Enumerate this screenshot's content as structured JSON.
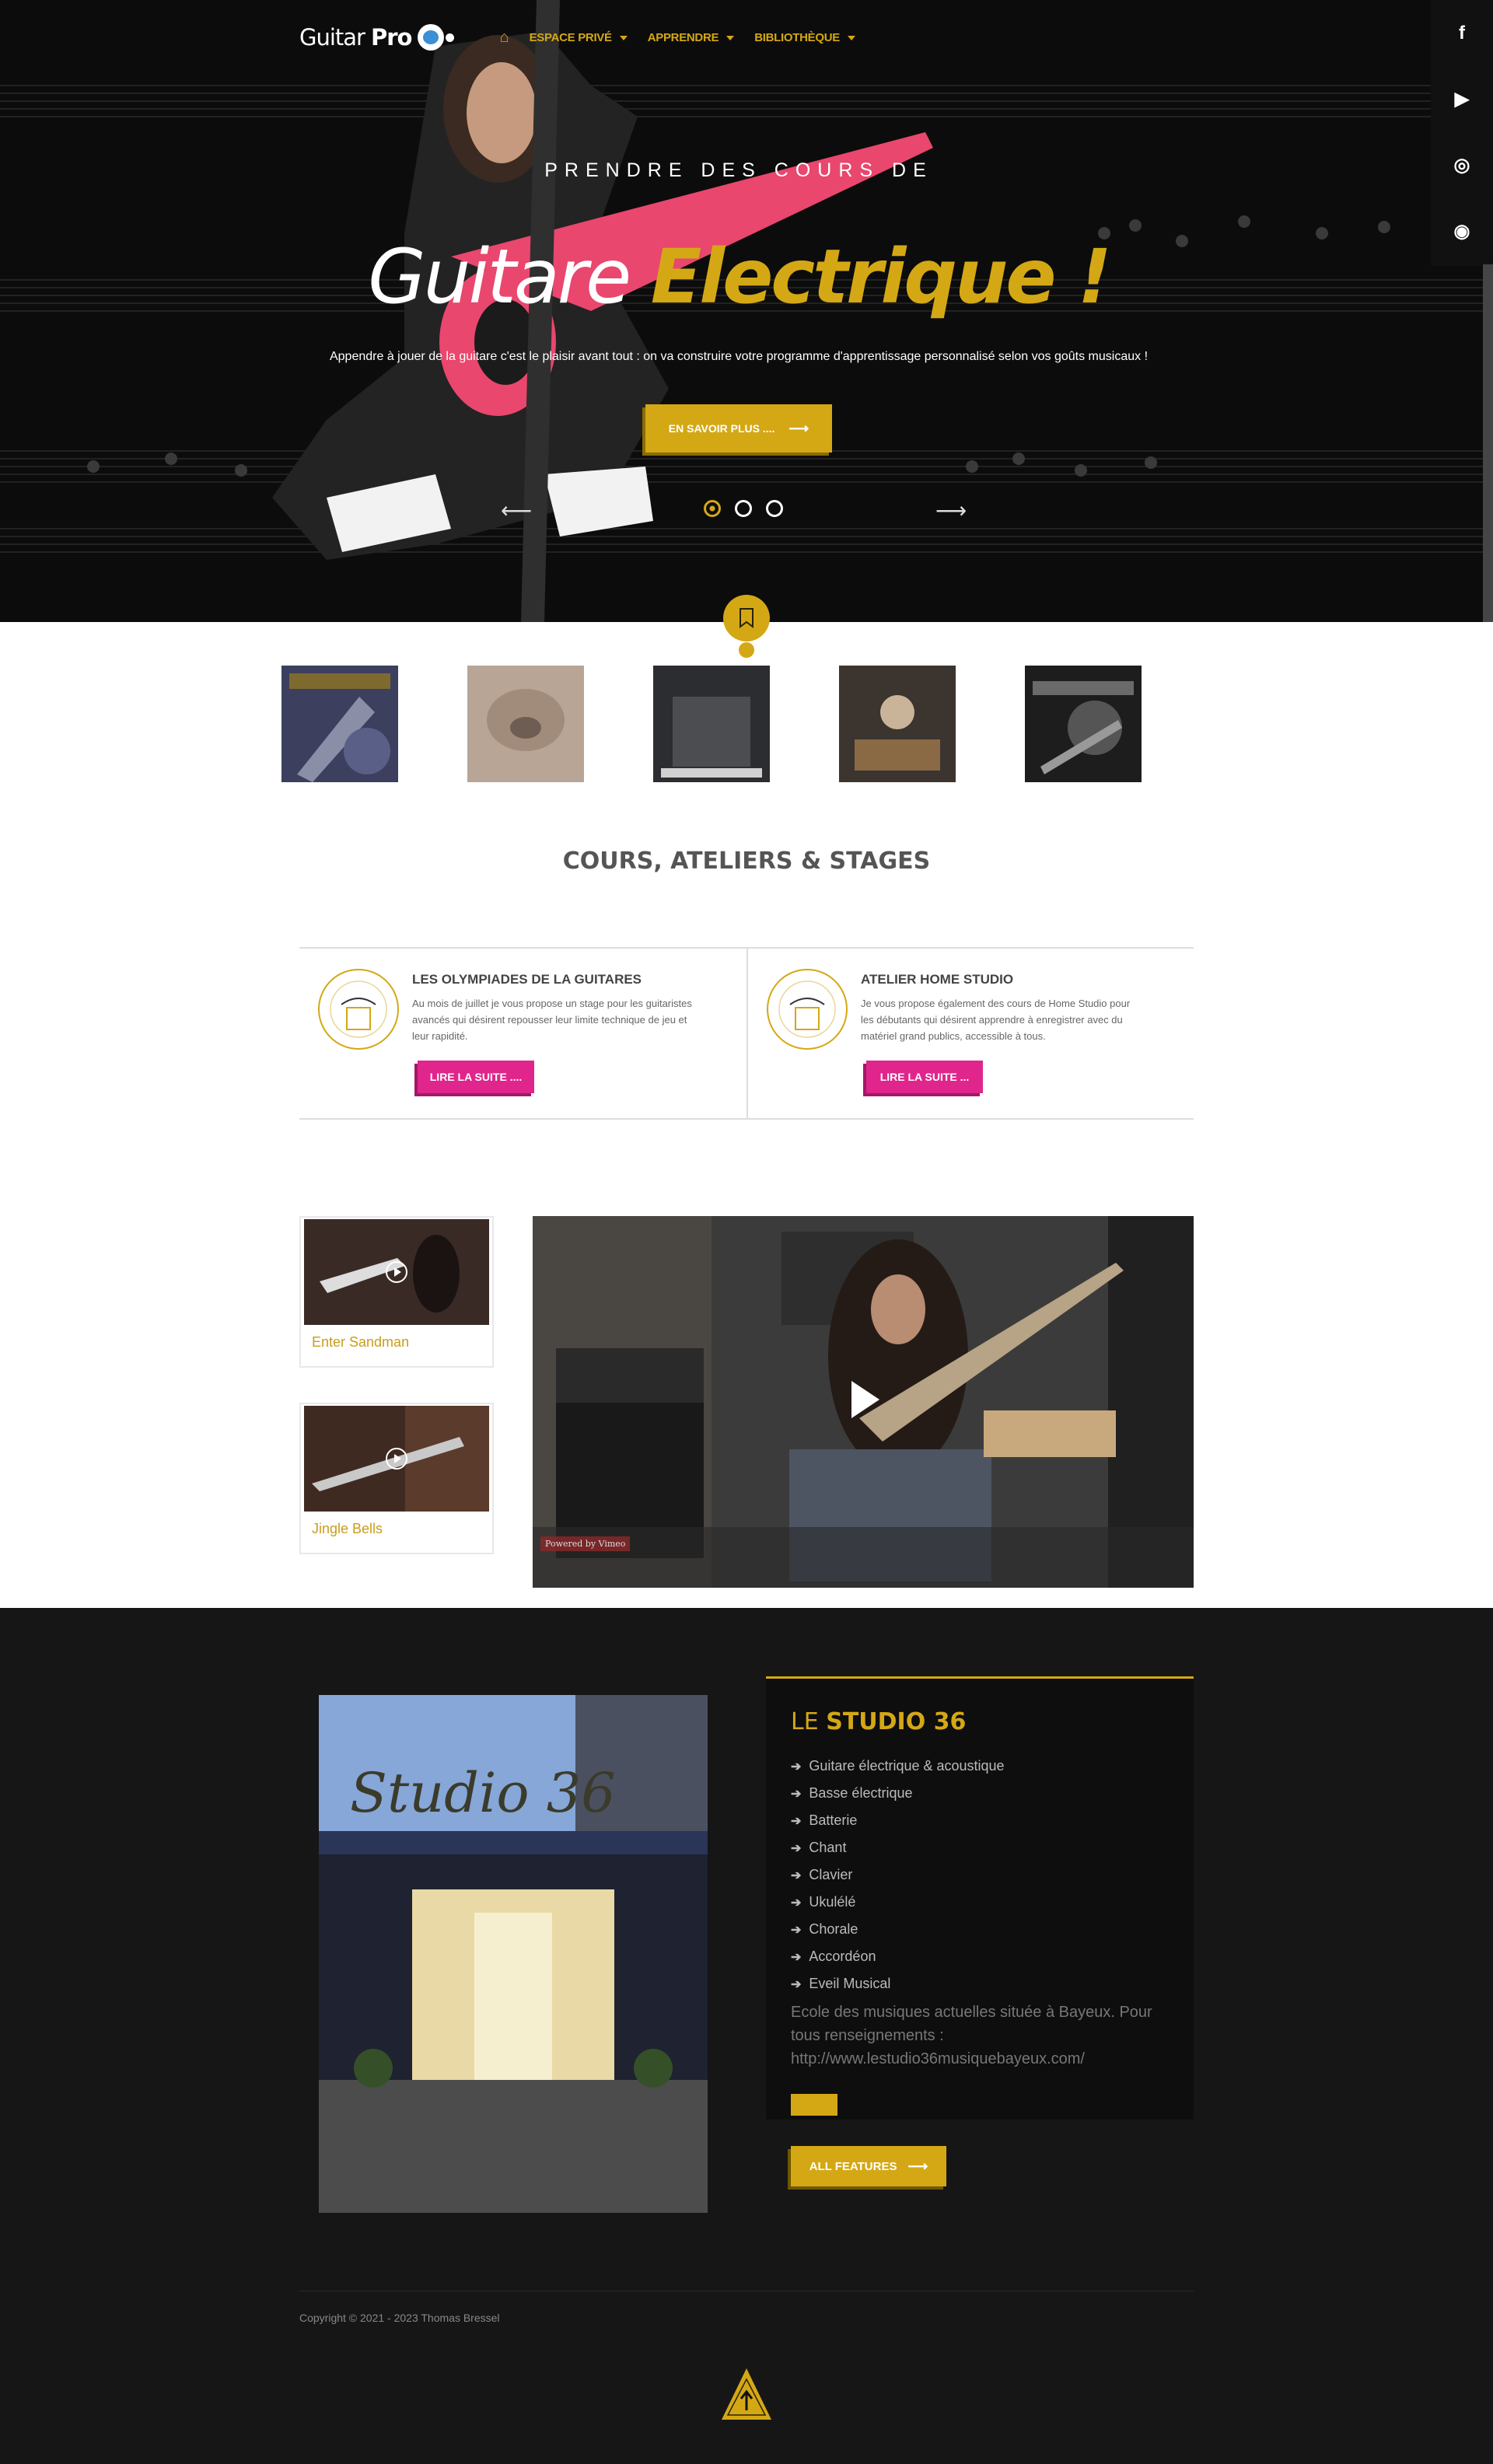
{
  "nav": {
    "logo_text": "Guitar",
    "logo_bold": "Pro",
    "home_icon": "home-icon",
    "items": [
      {
        "label": "ESPACE PRIVÉ"
      },
      {
        "label": "APPRENDRE"
      },
      {
        "label": "BIBLIOTHÈQUE"
      }
    ]
  },
  "social": [
    {
      "icon": "facebook-icon",
      "glyph": "f"
    },
    {
      "icon": "youtube-icon",
      "glyph": "▶"
    },
    {
      "icon": "instagram-icon",
      "glyph": "◎"
    },
    {
      "icon": "periscope-icon",
      "glyph": "◉"
    }
  ],
  "hero": {
    "pretitle": "PRENDRE DES COURS DE",
    "title_white": "Guitare",
    "title_yellow": "Electrique !",
    "subtitle": "Appendre à jouer de la guitare c'est le plaisir avant tout : on va construire votre programme d'apprentissage personnalisé selon vos goûts musicaux !",
    "cta_label": "EN SAVOIR PLUS ....",
    "slides": 3,
    "active_slide": 1
  },
  "courses_section": {
    "title": "COURS, ATELIERS & STAGES",
    "items": [
      {
        "title": "LES OLYMPIADES DE LA GUITARES",
        "text": "Au mois de juillet je vous propose un stage pour les guitaristes avancés qui désirent repousser leur limite technique de jeu et leur rapidité.",
        "button": "LIRE LA SUITE ...."
      },
      {
        "title": "ATELIER HOME STUDIO",
        "text": "Je vous propose également des cours de Home Studio pour les débutants qui désirent apprendre à enregistrer avec du matériel grand publics, accessible à tous.",
        "button": "LIRE LA SUITE ..."
      }
    ]
  },
  "videos": {
    "items": [
      {
        "label": "Enter Sandman"
      },
      {
        "label": "Jingle Bells"
      }
    ],
    "powered": "Powered by Vimeo"
  },
  "studio": {
    "title_light": "LE",
    "title_bold": "STUDIO 36",
    "list": [
      "Guitare électrique & acoustique",
      "Basse électrique",
      "Batterie",
      "Chant",
      "Clavier",
      "Ukulélé",
      "Chorale",
      "Accordéon",
      "Eveil Musical"
    ],
    "description": "Ecole des musiques actuelles située à Bayeux. Pour tous renseignements : http://www.lestudio36musiquebayeux.com/",
    "button": "ALL FEATURES"
  },
  "footer": {
    "copyright": "Copyright © 2021 - 2023 Thomas Bressel"
  },
  "colors": {
    "accent": "#d4a815",
    "pink": "#e0258c",
    "dark": "#161616"
  }
}
